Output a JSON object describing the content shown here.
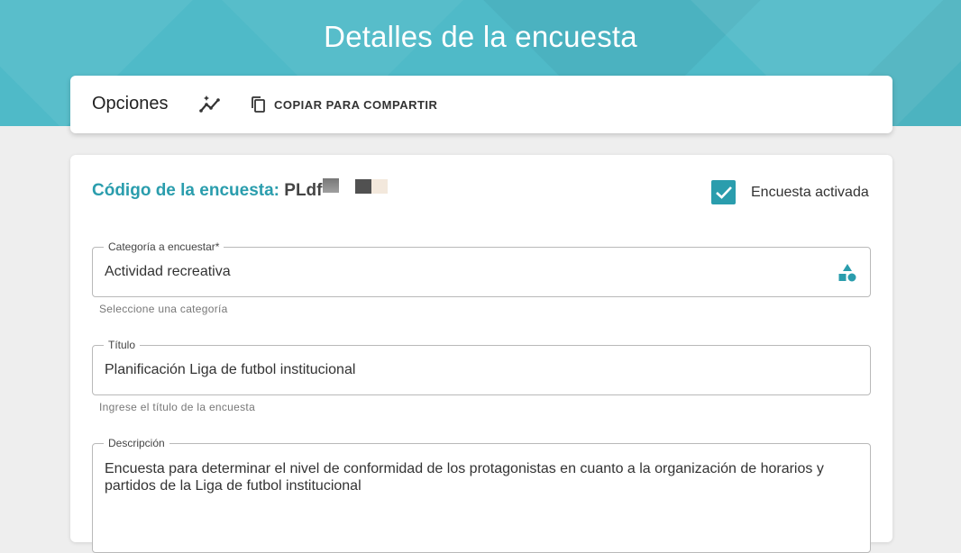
{
  "header": {
    "title": "Detalles de la encuesta"
  },
  "options": {
    "title": "Opciones",
    "stats_icon": "auto-graph-icon",
    "copy_icon": "copy-icon",
    "copy_label": "COPIAR PARA COMPARTIR"
  },
  "survey": {
    "code_label": "Código de la encuesta:",
    "code_value": "PLdf",
    "active_label": "Encuesta activada",
    "active_checked": true
  },
  "fields": {
    "category": {
      "label": "Categoría a encuestar*",
      "value": "Actividad recreativa",
      "hint": "Seleccione una categoría",
      "icon": "category-icon"
    },
    "title": {
      "label": "Título",
      "value": "Planificación Liga de futbol institucional",
      "hint": "Ingrese el título de la encuesta"
    },
    "description": {
      "label": "Descripción",
      "value": "Encuesta para determinar el nivel de conformidad de los protagonistas en cuanto a la organización de horarios y partidos de la Liga de futbol institucional"
    }
  },
  "colors": {
    "accent": "#2a9dad",
    "header_bg": "#4fbac8"
  }
}
